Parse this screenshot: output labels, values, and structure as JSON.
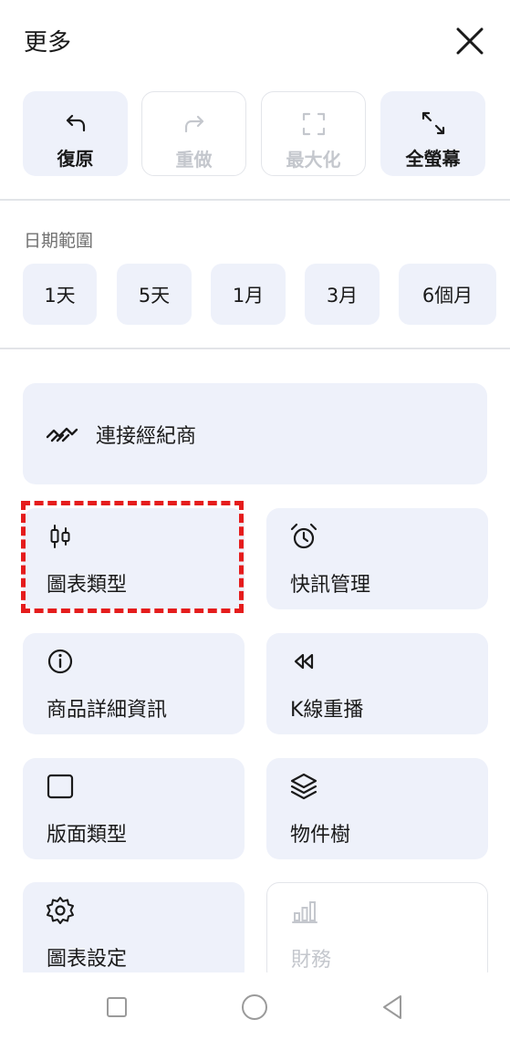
{
  "header": {
    "title": "更多",
    "close_icon": "close-icon"
  },
  "toolbar": [
    {
      "label": "復原",
      "icon": "undo-icon",
      "enabled": true
    },
    {
      "label": "重做",
      "icon": "redo-icon",
      "enabled": false
    },
    {
      "label": "最大化",
      "icon": "maximize-icon",
      "enabled": false
    },
    {
      "label": "全螢幕",
      "icon": "fullscreen-icon",
      "enabled": true
    }
  ],
  "date_range": {
    "label": "日期範圍",
    "options": [
      "1天",
      "5天",
      "1月",
      "3月",
      "6個月"
    ]
  },
  "broker": {
    "label": "連接經紀商",
    "icon": "handshake-icon"
  },
  "menu": [
    {
      "label": "圖表類型",
      "icon": "candlestick-icon",
      "enabled": true,
      "highlighted": true
    },
    {
      "label": "快訊管理",
      "icon": "alarm-clock-icon",
      "enabled": true
    },
    {
      "label": "商品詳細資訊",
      "icon": "info-icon",
      "enabled": true
    },
    {
      "label": "K線重播",
      "icon": "rewind-icon",
      "enabled": true
    },
    {
      "label": "版面類型",
      "icon": "square-icon",
      "enabled": true
    },
    {
      "label": "物件樹",
      "icon": "layers-icon",
      "enabled": true
    },
    {
      "label": "圖表設定",
      "icon": "gear-icon",
      "enabled": true
    },
    {
      "label": "財務",
      "icon": "bar-chart-icon",
      "enabled": false
    }
  ],
  "colors": {
    "tile_bg": "#eef1fa",
    "highlight": "#e51c1c",
    "disabled_text": "#c4c7cd"
  },
  "system_nav": [
    "recent-apps-icon",
    "home-icon",
    "back-icon"
  ]
}
